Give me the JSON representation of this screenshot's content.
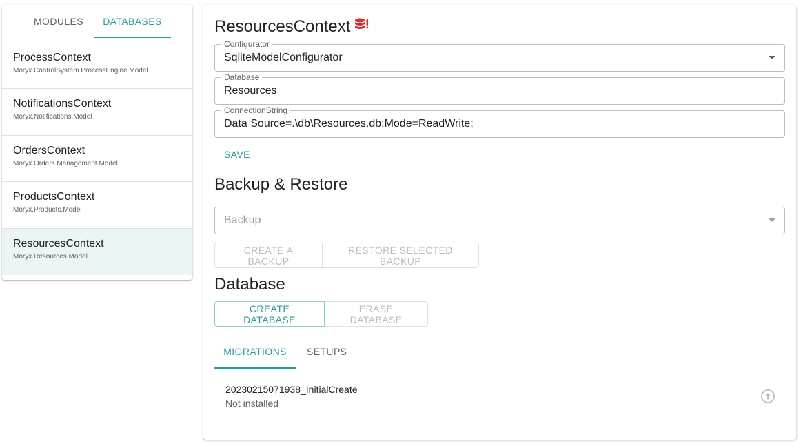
{
  "sidebar": {
    "tabs": [
      {
        "label": "MODULES"
      },
      {
        "label": "DATABASES"
      }
    ],
    "items": [
      {
        "name": "ProcessContext",
        "namespace": "Moryx.ControlSystem.ProcessEngine.Model"
      },
      {
        "name": "NotificationsContext",
        "namespace": "Moryx.Notifications.Model"
      },
      {
        "name": "OrdersContext",
        "namespace": "Moryx.Orders.Management.Model"
      },
      {
        "name": "ProductsContext",
        "namespace": "Moryx.Products.Model"
      },
      {
        "name": "ResourcesContext",
        "namespace": "Moryx.Resources.Model"
      }
    ]
  },
  "main": {
    "title": "ResourcesContext",
    "fields": {
      "configurator": {
        "label": "Configurator",
        "value": "SqliteModelConfigurator"
      },
      "database": {
        "label": "Database",
        "value": "Resources"
      },
      "connection_string": {
        "label": "ConnectionString",
        "value": "Data Source=.\\db\\Resources.db;Mode=ReadWrite;"
      }
    },
    "save_label": "SAVE",
    "backup_section": {
      "title": "Backup & Restore",
      "select_placeholder": "Backup",
      "create_label": "CREATE A BACKUP",
      "restore_label": "RESTORE SELECTED BACKUP"
    },
    "database_section": {
      "title": "Database",
      "create_label": "CREATE DATABASE",
      "erase_label": "ERASE DATABASE"
    },
    "tabs": [
      {
        "label": "MIGRATIONS"
      },
      {
        "label": "SETUPS"
      }
    ],
    "migrations": [
      {
        "name": "20230215071938_InitialCreate",
        "status": "Not installed"
      }
    ]
  },
  "colors": {
    "accent": "#2a9a9f",
    "db_warning": "#d32f2f",
    "selected_bg": "#ebf5f5"
  }
}
